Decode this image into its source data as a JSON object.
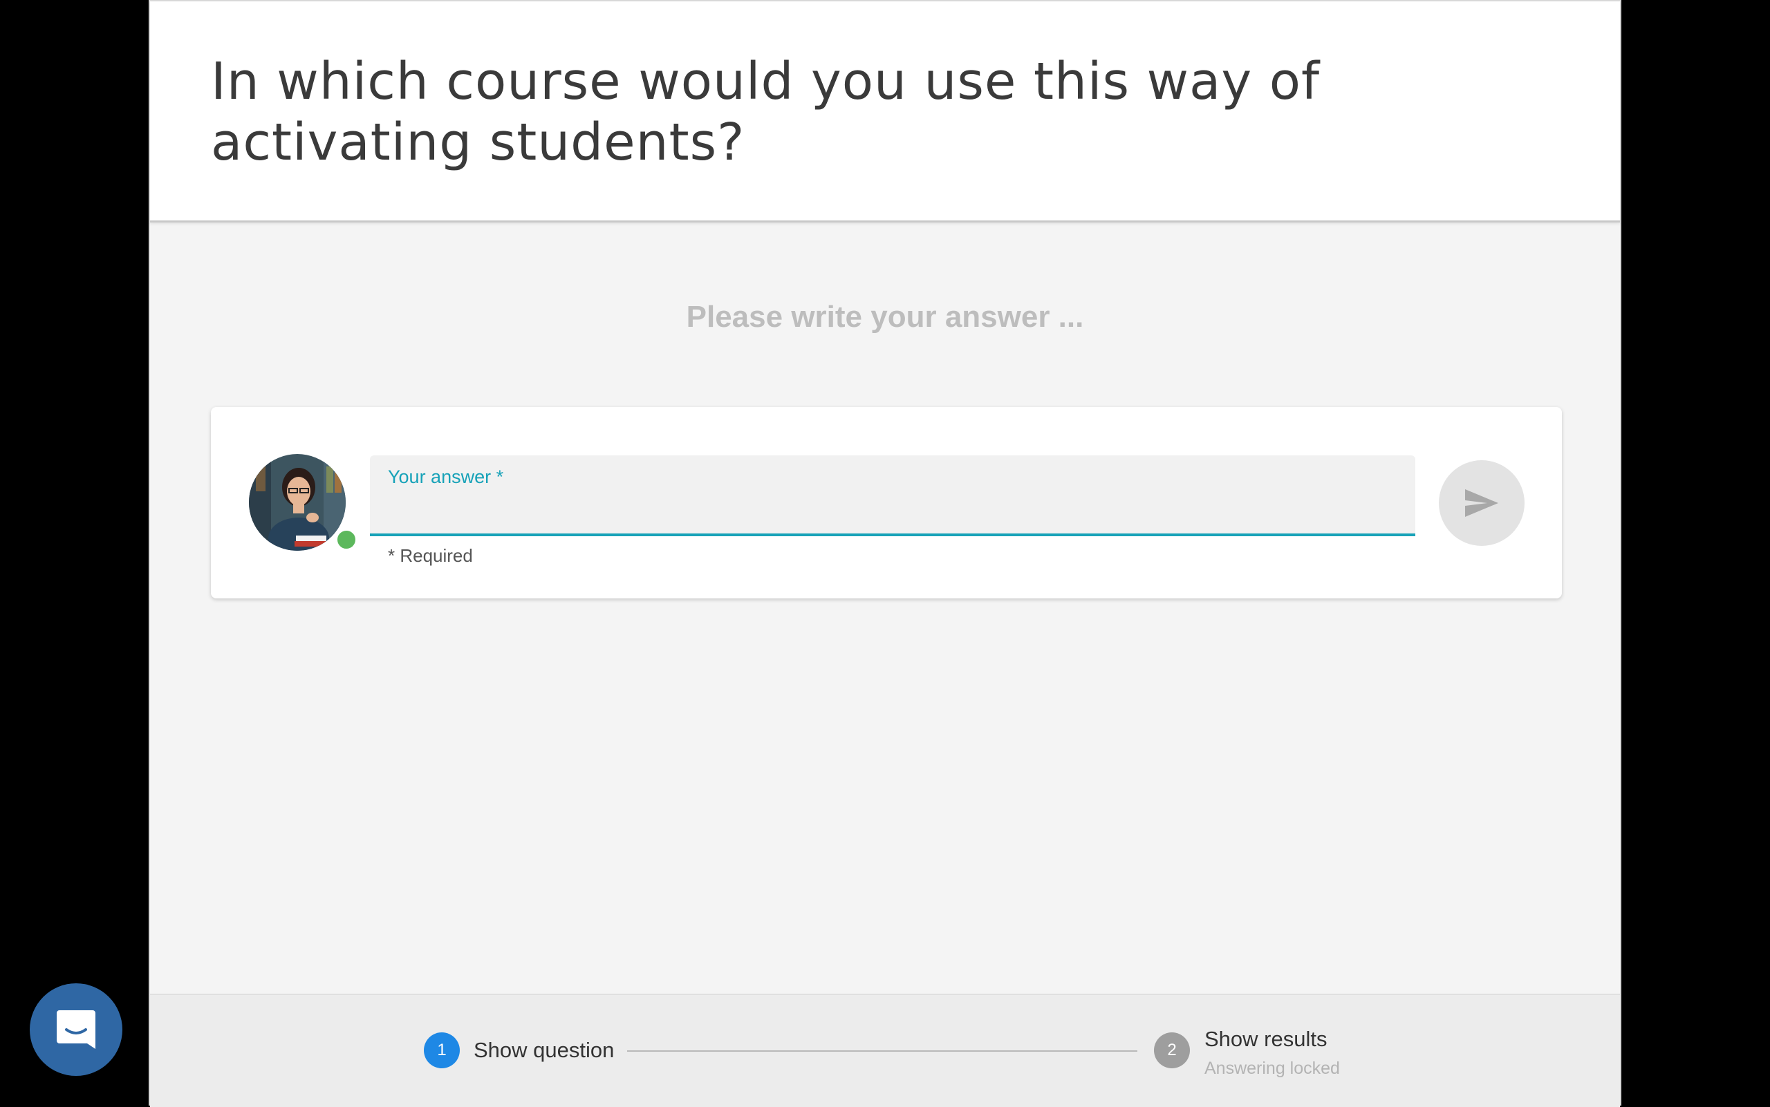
{
  "header": {
    "question": "In which course would you use this way of activating students?"
  },
  "main": {
    "prompt": "Please write your answer ...",
    "answer_field": {
      "label": "Your answer *",
      "value": "",
      "helper": "* Required"
    }
  },
  "stepper": {
    "steps": [
      {
        "number": "1",
        "label": "Show question",
        "state": "active"
      },
      {
        "number": "2",
        "label": "Show results",
        "sublabel": "Answering locked",
        "state": "inactive"
      }
    ]
  },
  "colors": {
    "accent": "#17a2b8",
    "step_active": "#1e88e5",
    "step_inactive": "#9e9e9e",
    "online": "#5cb85c",
    "chat_launcher": "#2f67a4"
  },
  "icons": {
    "send": "send-icon",
    "chat": "chat-icon"
  }
}
